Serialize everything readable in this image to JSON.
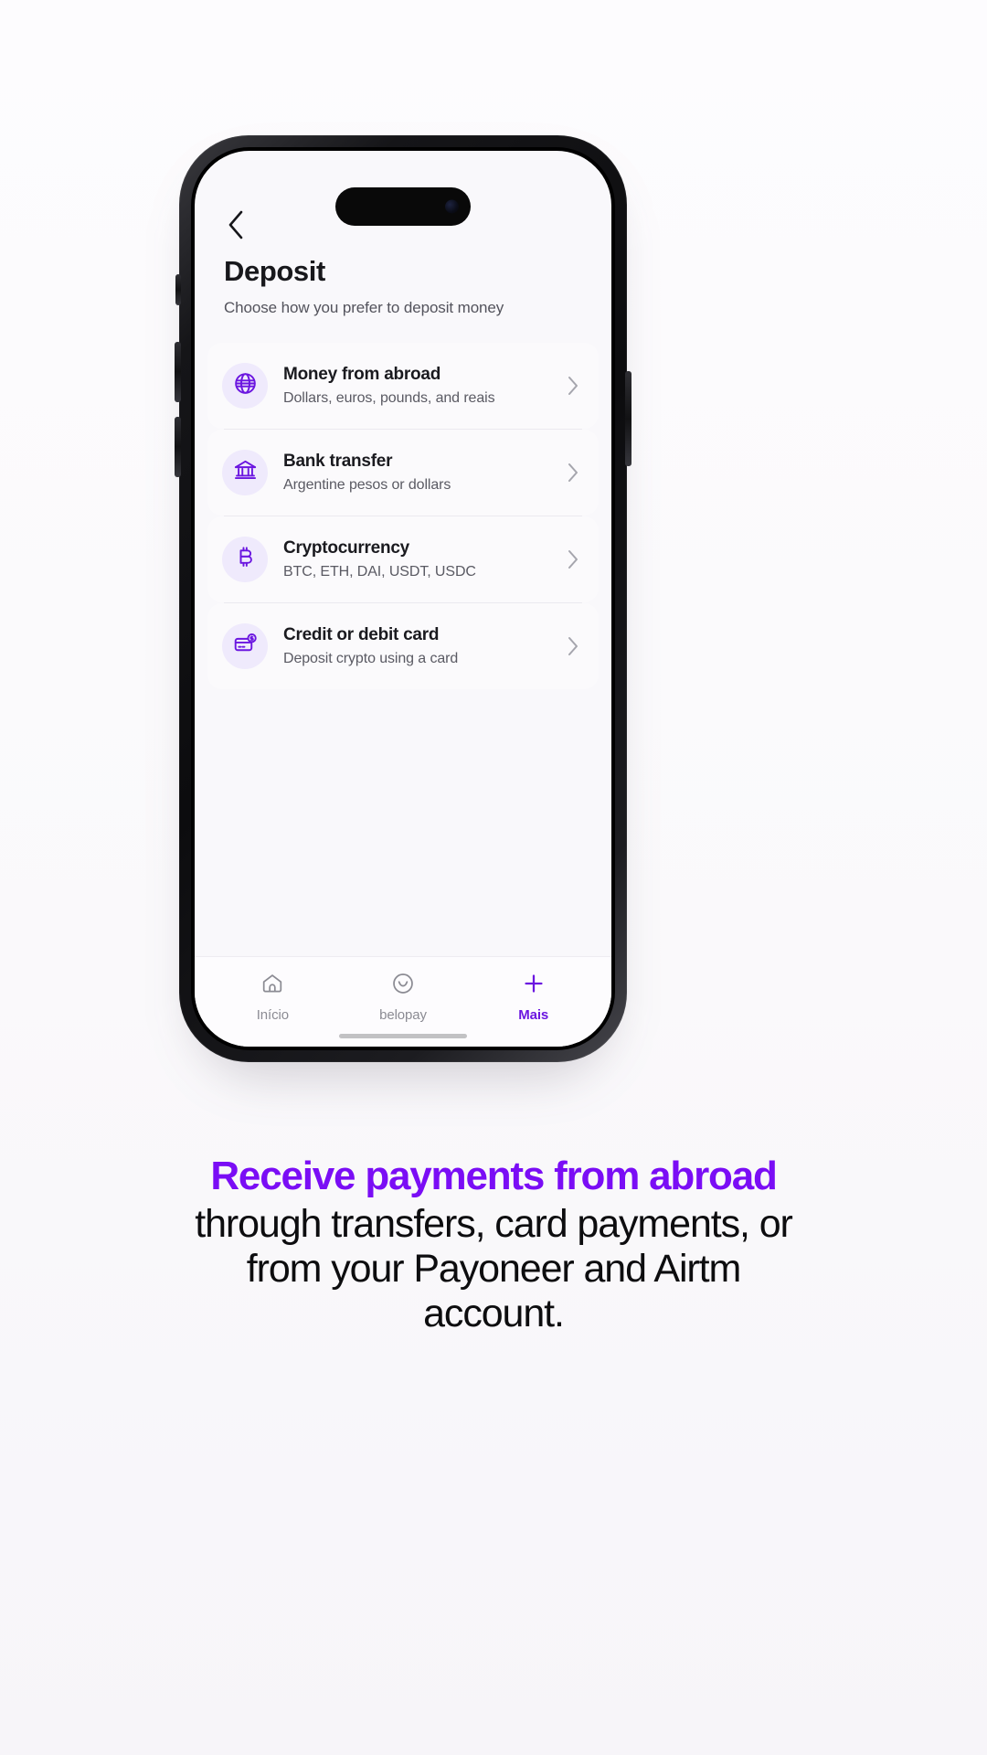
{
  "background_color": "#faf8fb",
  "accent_color": "#6b16e0",
  "caption_accent_color": "#7a0df5",
  "phone": {
    "status_bar": {
      "dynamic_island": "dynamic-island"
    },
    "screen": {
      "back_icon": "chevron-left-icon",
      "title": "Deposit",
      "subtitle": "Choose how you prefer to deposit money",
      "options": [
        {
          "icon": "globe-icon",
          "title": "Money from abroad",
          "subtitle": "Dollars, euros, pounds, and reais",
          "chevron": "chevron-right-icon"
        },
        {
          "icon": "bank-icon",
          "title": "Bank transfer",
          "subtitle": "Argentine pesos or dollars",
          "chevron": "chevron-right-icon"
        },
        {
          "icon": "bitcoin-icon",
          "title": "Cryptocurrency",
          "subtitle": "BTC, ETH, DAI, USDT, USDC",
          "chevron": "chevron-right-icon"
        },
        {
          "icon": "credit-card-icon",
          "title": "Credit or debit card",
          "subtitle": "Deposit crypto using a card",
          "chevron": "chevron-right-icon"
        }
      ],
      "tabbar": [
        {
          "icon": "home-icon",
          "label": "Início",
          "active": false
        },
        {
          "icon": "smiley-icon",
          "label": "belopay",
          "active": false
        },
        {
          "icon": "plus-icon",
          "label": "Mais",
          "active": true
        }
      ]
    }
  },
  "caption": {
    "headline": "Receive payments from abroad",
    "line2": "through transfers, card payments, or",
    "line3": "from your Payoneer and Airtm",
    "line4": "account."
  }
}
